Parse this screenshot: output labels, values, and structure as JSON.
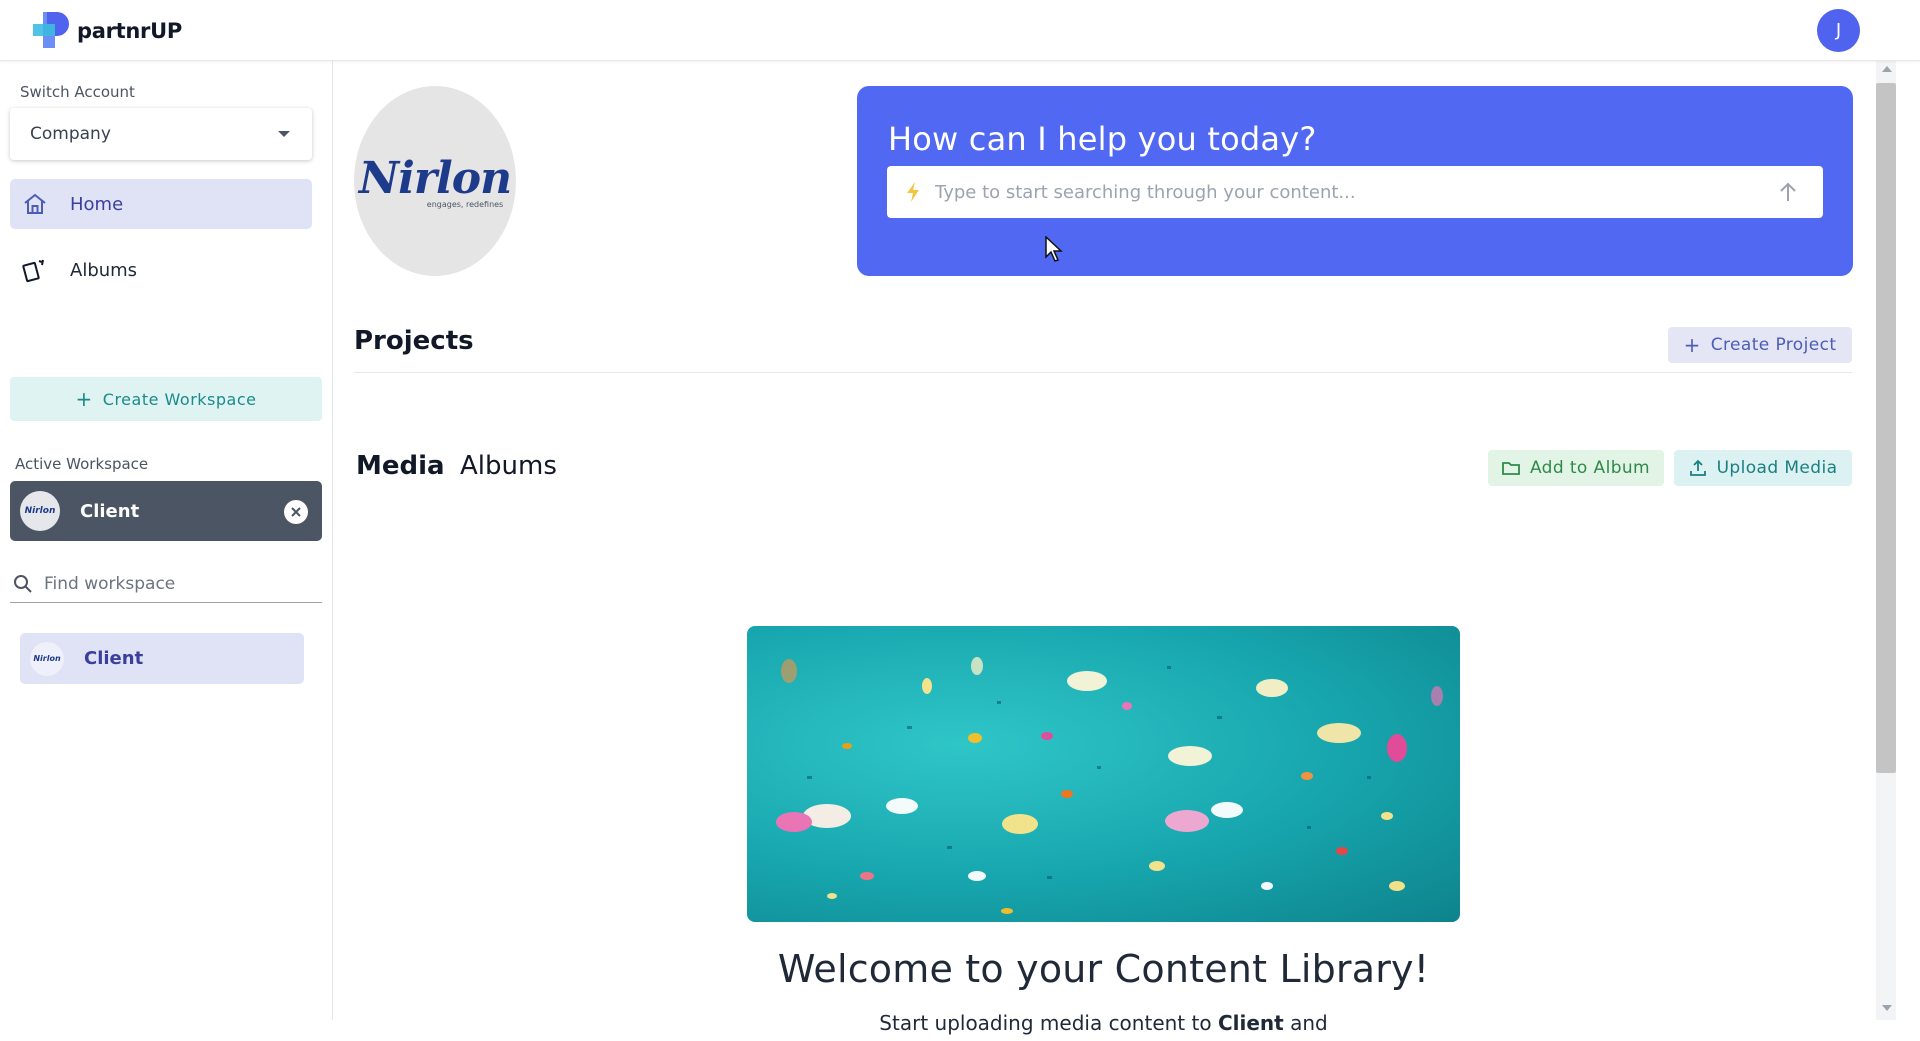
{
  "app": {
    "name": "partnrUP",
    "user_initial": "J"
  },
  "sidebar": {
    "switch_account_label": "Switch Account",
    "account_select": "Company",
    "nav": [
      {
        "label": "Home",
        "icon": "home-icon",
        "active": true
      },
      {
        "label": "Albums",
        "icon": "albums-icon",
        "active": false
      }
    ],
    "create_workspace_label": "Create Workspace",
    "active_workspace_label": "Active Workspace",
    "active_workspace_name": "Client",
    "find_workspace_placeholder": "Find workspace",
    "workspace_list": [
      {
        "name": "Client"
      }
    ]
  },
  "main": {
    "company_logo_text": "Nirlon",
    "company_logo_tagline": "engages, redefines",
    "help": {
      "title": "How can I help you today?",
      "search_placeholder": "Type to start searching through your content..."
    },
    "projects": {
      "title": "Projects",
      "create_label": "Create Project"
    },
    "tabs": [
      {
        "label": "Media",
        "active": true
      },
      {
        "label": "Albums",
        "active": false
      }
    ],
    "add_to_album_label": "Add to Album",
    "upload_media_label": "Upload Media",
    "welcome_title": "Welcome to your Content Library!",
    "welcome_subtitle_prefix": "Start uploading media content to",
    "welcome_subtitle_workspace": "Client",
    "welcome_subtitle_suffix": "and"
  },
  "colors": {
    "brand_blue": "#5068f2",
    "teal": "#1b8a8a",
    "active_nav_bg": "#e0e2f6",
    "active_workspace_bg": "#4b5563"
  }
}
